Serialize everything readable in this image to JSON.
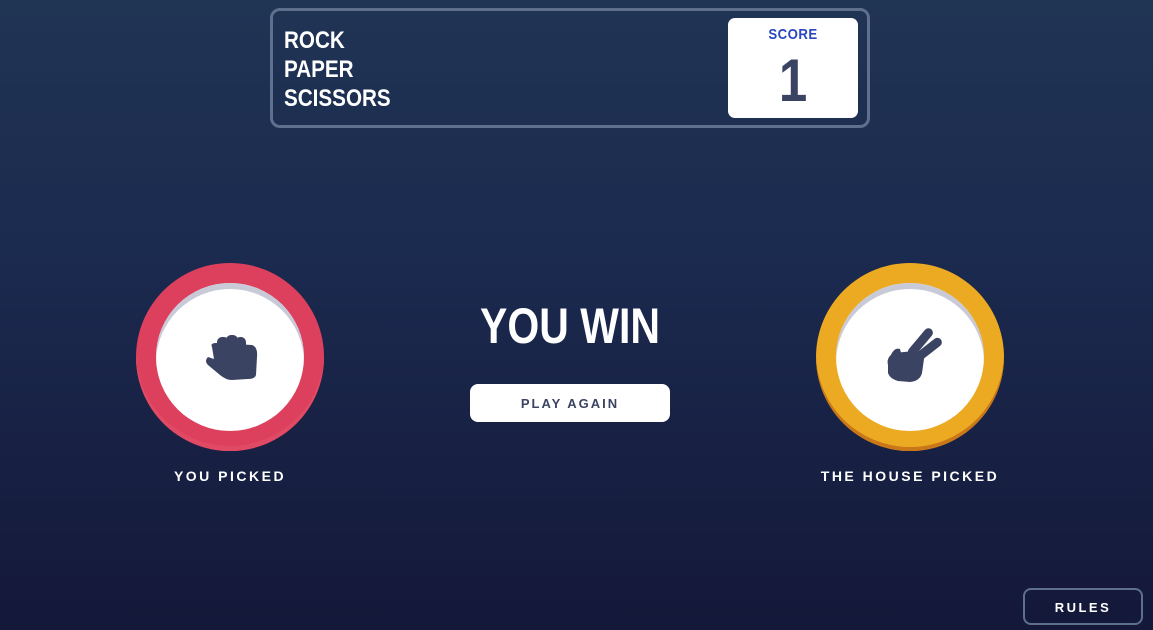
{
  "header": {
    "title_lines": [
      "ROCK",
      "PAPER",
      "SCISSORS"
    ],
    "score_label": "SCORE",
    "score_value": "1"
  },
  "player": {
    "choice": "rock",
    "icon": "rock-fist-icon",
    "label": "YOU PICKED",
    "color": "#dd405d"
  },
  "house": {
    "choice": "scissors",
    "icon": "scissors-hand-icon",
    "label": "THE HOUSE PICKED",
    "color": "#eca922"
  },
  "result": {
    "text": "YOU WIN",
    "play_again_label": "PLAY AGAIN"
  },
  "footer": {
    "rules_label": "RULES"
  }
}
